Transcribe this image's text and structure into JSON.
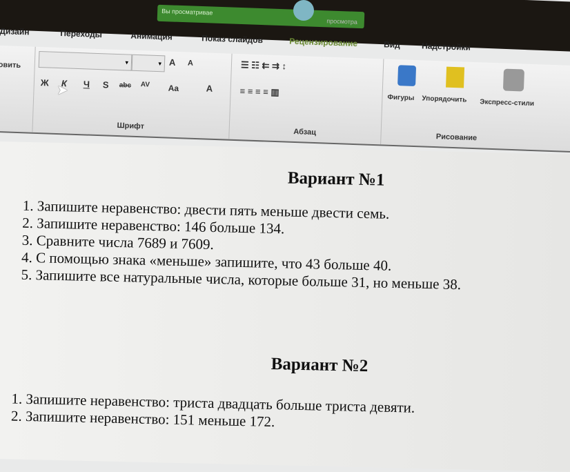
{
  "notification": {
    "text_left": "Вы просматривае",
    "text_right": "просмотра"
  },
  "tabs": [
    "Дизайн",
    "Переходы",
    "Анимация",
    "Показ слайдов",
    "Рецензирование",
    "Вид",
    "Надстройки"
  ],
  "ribbon": {
    "clipboard_partial": "овить",
    "font_group": {
      "label": "Шрифт",
      "buttons": [
        "Ж",
        "К",
        "Ч",
        "S",
        "abc",
        "AV",
        "Aa",
        "A",
        "A",
        "A"
      ]
    },
    "paragraph_group": {
      "label": "Абзац"
    },
    "drawing_group": {
      "label": "Рисование",
      "buttons": [
        "Фигуры",
        "Упорядочить",
        "Экспресс-стили"
      ]
    }
  },
  "document": {
    "variant1": {
      "title": "Вариант №1",
      "items": [
        "Запишите неравенство: двести пять меньше двести семь.",
        "Запишите неравенство:  146  больше 134.",
        "Сравните числа 7689 и 7609.",
        "С помощью знака «меньше» запишите, что 43 больше 40.",
        "Запишите все натуральные числа, которые больше 31, но меньше 38."
      ]
    },
    "variant2": {
      "title": "Вариант №2",
      "items": [
        "Запишите неравенство: триста двадцать  больше триста девяти.",
        "Запишите неравенство:  151 меньше 172."
      ]
    }
  }
}
